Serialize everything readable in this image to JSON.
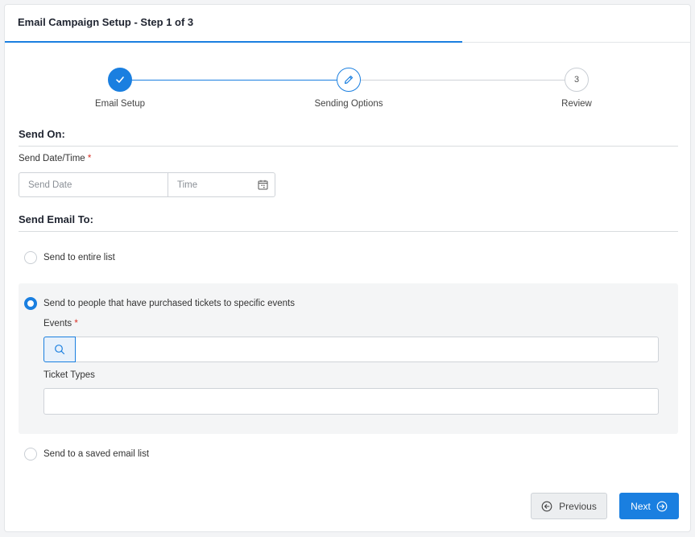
{
  "header": {
    "title": "Email Campaign Setup - Step 1 of 3"
  },
  "stepper": {
    "steps": [
      {
        "label": "Email Setup",
        "status": "complete"
      },
      {
        "label": "Sending Options",
        "status": "active"
      },
      {
        "label": "Review",
        "status": "pending",
        "number": "3"
      }
    ]
  },
  "send_on": {
    "title": "Send On:",
    "datetime_label": "Send Date/Time",
    "required_mark": "*",
    "date_placeholder": "Send Date",
    "time_placeholder": "Time"
  },
  "send_to": {
    "title": "Send Email To:",
    "options": [
      {
        "label": "Send to entire list",
        "selected": false
      },
      {
        "label": "Send to people that have purchased tickets to specific events",
        "selected": true
      },
      {
        "label": "Send to a saved email list",
        "selected": false
      }
    ],
    "events_label": "Events",
    "required_mark": "*",
    "ticket_types_label": "Ticket Types"
  },
  "footer": {
    "previous_label": "Previous",
    "next_label": "Next"
  },
  "colors": {
    "accent": "#1a7fe0",
    "panel_bg": "#f4f5f6",
    "required": "#d93025"
  }
}
